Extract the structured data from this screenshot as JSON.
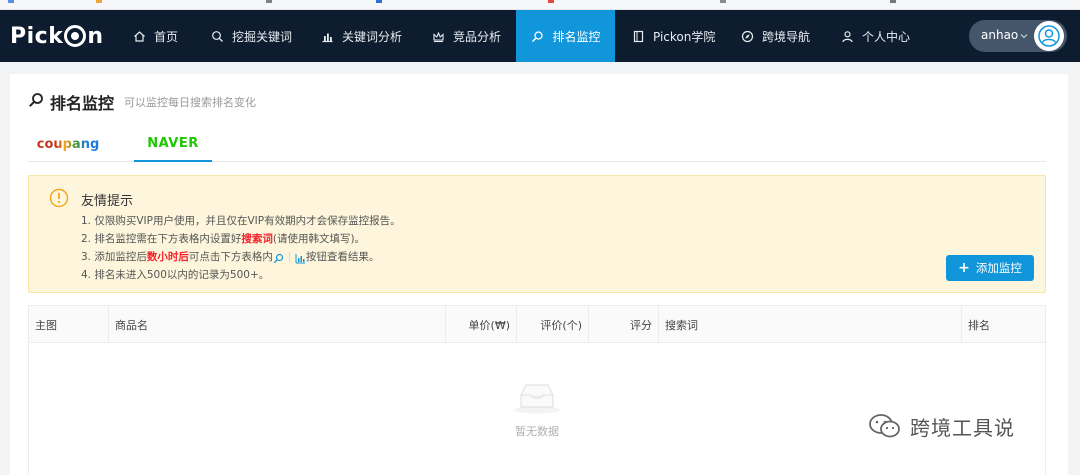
{
  "brand": {
    "logo_text_left": "Pick",
    "logo_text_right": "n"
  },
  "nav": {
    "items": [
      {
        "label": "首页",
        "icon": "home-icon"
      },
      {
        "label": "挖掘关键词",
        "icon": "search-icon"
      },
      {
        "label": "关键词分析",
        "icon": "bar-chart-icon"
      },
      {
        "label": "竞品分析",
        "icon": "crown-icon"
      },
      {
        "label": "排名监控",
        "icon": "monitor-search-icon",
        "active": true
      },
      {
        "label": "Pickon学院",
        "icon": "book-icon"
      },
      {
        "label": "跨境导航",
        "icon": "compass-icon"
      },
      {
        "label": "个人中心",
        "icon": "person-icon"
      }
    ],
    "username": "anhao"
  },
  "page": {
    "title": "排名监控",
    "subtitle": "可以监控每日搜索排名变化"
  },
  "tabs": {
    "coupang": "coupang",
    "naver": "NAVER",
    "active": "naver"
  },
  "notice": {
    "title": "友情提示",
    "line1": "1. 仅限购买VIP用户使用，并且仅在VIP有效期内才会保存监控报告。",
    "line2_pre": "2. 排名监控需在下方表格内设置好",
    "line2_red": "搜索词",
    "line2_post": "(请使用韩文填写)。",
    "line3_pre": "3. 添加监控后",
    "line3_red": "数小时后",
    "line3_mid": "可点击下方表格内",
    "line3_post": "按钮查看结果。",
    "line4": "4. 排名未进入500以内的记录为500+。"
  },
  "add_button": {
    "label": "添加监控"
  },
  "table": {
    "columns": [
      "主图",
      "商品名",
      "单价(₩)",
      "评价(个)",
      "评分",
      "搜索词",
      "排名"
    ],
    "empty_text": "暂无数据"
  },
  "watermark": {
    "text": "跨境工具说"
  },
  "colors": {
    "nav_bg": "#0d1c2e",
    "accent": "#1296db",
    "naver_green": "#1ec800",
    "notice_bg": "#fdf6dd",
    "warning_red": "#f5222d"
  }
}
